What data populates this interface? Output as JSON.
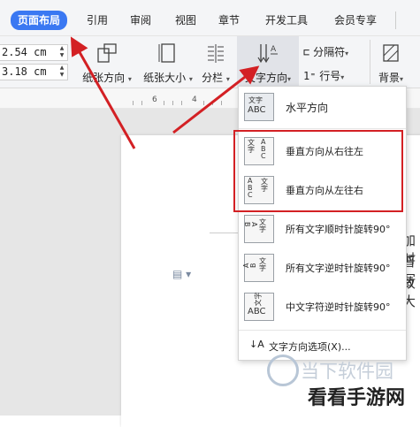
{
  "tabs": [
    "页面布局",
    "引用",
    "审阅",
    "视图",
    "章节",
    "开发工具",
    "会员专享"
  ],
  "spinners": [
    "2.54 cm",
    "3.18 cm"
  ],
  "ribbon": {
    "orientation_label": "纸张方向",
    "size_label": "纸张大小",
    "columns_label": "分栏",
    "text_dir_label": "文字方向",
    "separator_label": "分隔符",
    "line_num_label": "行号",
    "background_label": "背景"
  },
  "ruler_numbers": [
    "6",
    "4"
  ],
  "menu": {
    "items": [
      {
        "label": "水平方向",
        "icon_text": "文字 ABC"
      },
      {
        "label": "垂直方向从右往左",
        "icon_text": "ABC 文字"
      },
      {
        "label": "垂直方向从左往右",
        "icon_text": "文字 ABC"
      },
      {
        "label": "所有文字顺时针旋转90°",
        "icon_text": "ABC 文字"
      },
      {
        "label": "所有文字逆时针旋转90°",
        "icon_text": "ABC 文字"
      },
      {
        "label": "中文字符逆时针旋转90°",
        "icon_text": "文字 ABC"
      }
    ],
    "options_label": "文字方向选项(X)..."
  },
  "doc_text": [
    "加时",
    "普写",
    "故大"
  ],
  "watermarks": {
    "site1": "当下软件园",
    "site2": "看看手游网"
  },
  "colors": {
    "accent": "#3a78f2",
    "highlight": "#d32024",
    "arrow": "#d32024"
  }
}
